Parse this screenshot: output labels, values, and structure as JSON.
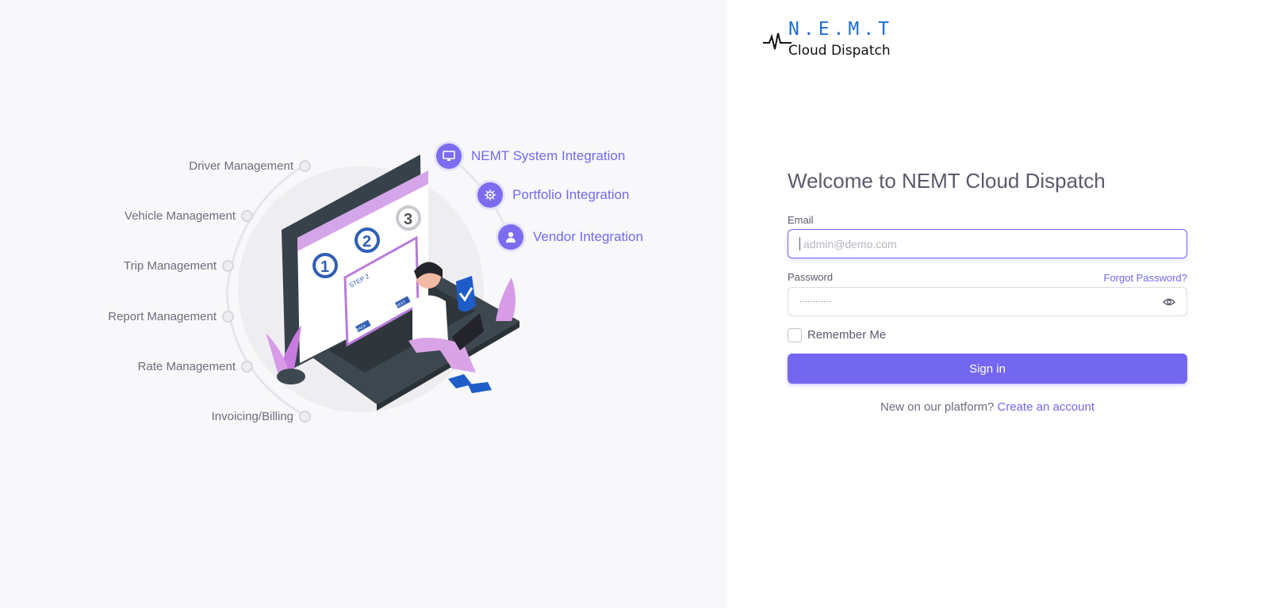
{
  "left": {
    "features_left": [
      {
        "label": "Driver Management"
      },
      {
        "label": "Vehicle Management"
      },
      {
        "label": "Trip Management"
      },
      {
        "label": "Report Management"
      },
      {
        "label": "Rate Management"
      },
      {
        "label": "Invoicing/Billing"
      }
    ],
    "features_right": [
      {
        "label": "NEMT System Integration",
        "icon": "monitor-icon"
      },
      {
        "label": "Portfolio Integration",
        "icon": "gear-brain-icon"
      },
      {
        "label": "Vendor Integration",
        "icon": "person-icon"
      }
    ],
    "illustration": {
      "step_numbers": [
        "1",
        "2",
        "3"
      ],
      "step_label": "STEP 2",
      "back_label": "BACK",
      "next_label": "NEXT"
    }
  },
  "logo": {
    "top": "N.E.M.T",
    "bottom": "Cloud Dispatch"
  },
  "form": {
    "title": "Welcome to NEMT Cloud Dispatch",
    "email_label": "Email",
    "email_placeholder": "admin@demo.com",
    "password_label": "Password",
    "password_value": "············",
    "forgot_label": "Forgot Password?",
    "remember_label": "Remember Me",
    "signin_label": "Sign in",
    "new_text": "New on our platform?",
    "create_label": "Create an account"
  },
  "colors": {
    "accent": "#7367f0",
    "left_bg": "#f8f8fa",
    "text": "#5d596c"
  }
}
